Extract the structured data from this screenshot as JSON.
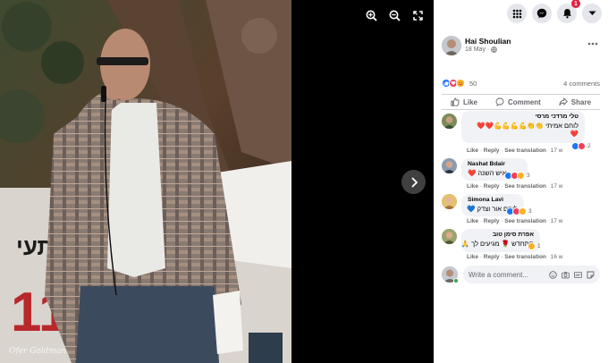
{
  "photo": {
    "watermark": "Ofer Goldman",
    "tools": [
      "zoom-in-icon",
      "zoom-out-icon",
      "fullscreen-icon"
    ],
    "next": "chevron-right-icon"
  },
  "topbar": {
    "icons": [
      "grid-menu-icon",
      "messenger-icon",
      "notifications-bell-icon",
      "account-dropdown-icon"
    ],
    "notification_count": "1"
  },
  "post": {
    "author": "Hai Shoulian",
    "date": "18 May",
    "privacy_icon": "globe-icon",
    "reaction_count": "50",
    "comment_count": "4 comments",
    "actions": {
      "like": "Like",
      "comment": "Comment",
      "share": "Share"
    }
  },
  "comments": [
    {
      "name": "טלי מרדכי מרסי",
      "text": "לוחם אמיתי 👏👏💪💪💪💪❤️❤️",
      "text_extra": "❤️",
      "like": "Like",
      "reply": "Reply",
      "see_translation": "See translation",
      "time": "17 w",
      "reactions": "2"
    },
    {
      "name": "Nashat Bdair",
      "text": "איש השנה ❤️",
      "like": "Like",
      "reply": "Reply",
      "see_translation": "See translation",
      "time": "17 w",
      "reactions": "3"
    },
    {
      "name": "Simona Lavi",
      "text": "לוחם אור וצדק 💙",
      "like": "Like",
      "reply": "Reply",
      "see_translation": "See translation",
      "time": "17 w",
      "reactions": "3"
    },
    {
      "name": "אפרת סימן טוב",
      "text": "תתחדש 🌹 מגיעים לך 🙏",
      "like": "Like",
      "reply": "Reply",
      "see_translation": "See translation",
      "time": "16 w",
      "reactions": "1"
    }
  ],
  "composer": {
    "placeholder": "Write a comment...",
    "icons": [
      "emoji-icon",
      "camera-icon",
      "gif-icon",
      "sticker-icon"
    ]
  },
  "colors": {
    "like_blue": "#1877f2",
    "love_red": "#f33e58",
    "haha_yellow": "#f7b125",
    "panel_bg": "#ffffff",
    "bubble_bg": "#f0f2f5",
    "secondary_text": "#65676b"
  }
}
